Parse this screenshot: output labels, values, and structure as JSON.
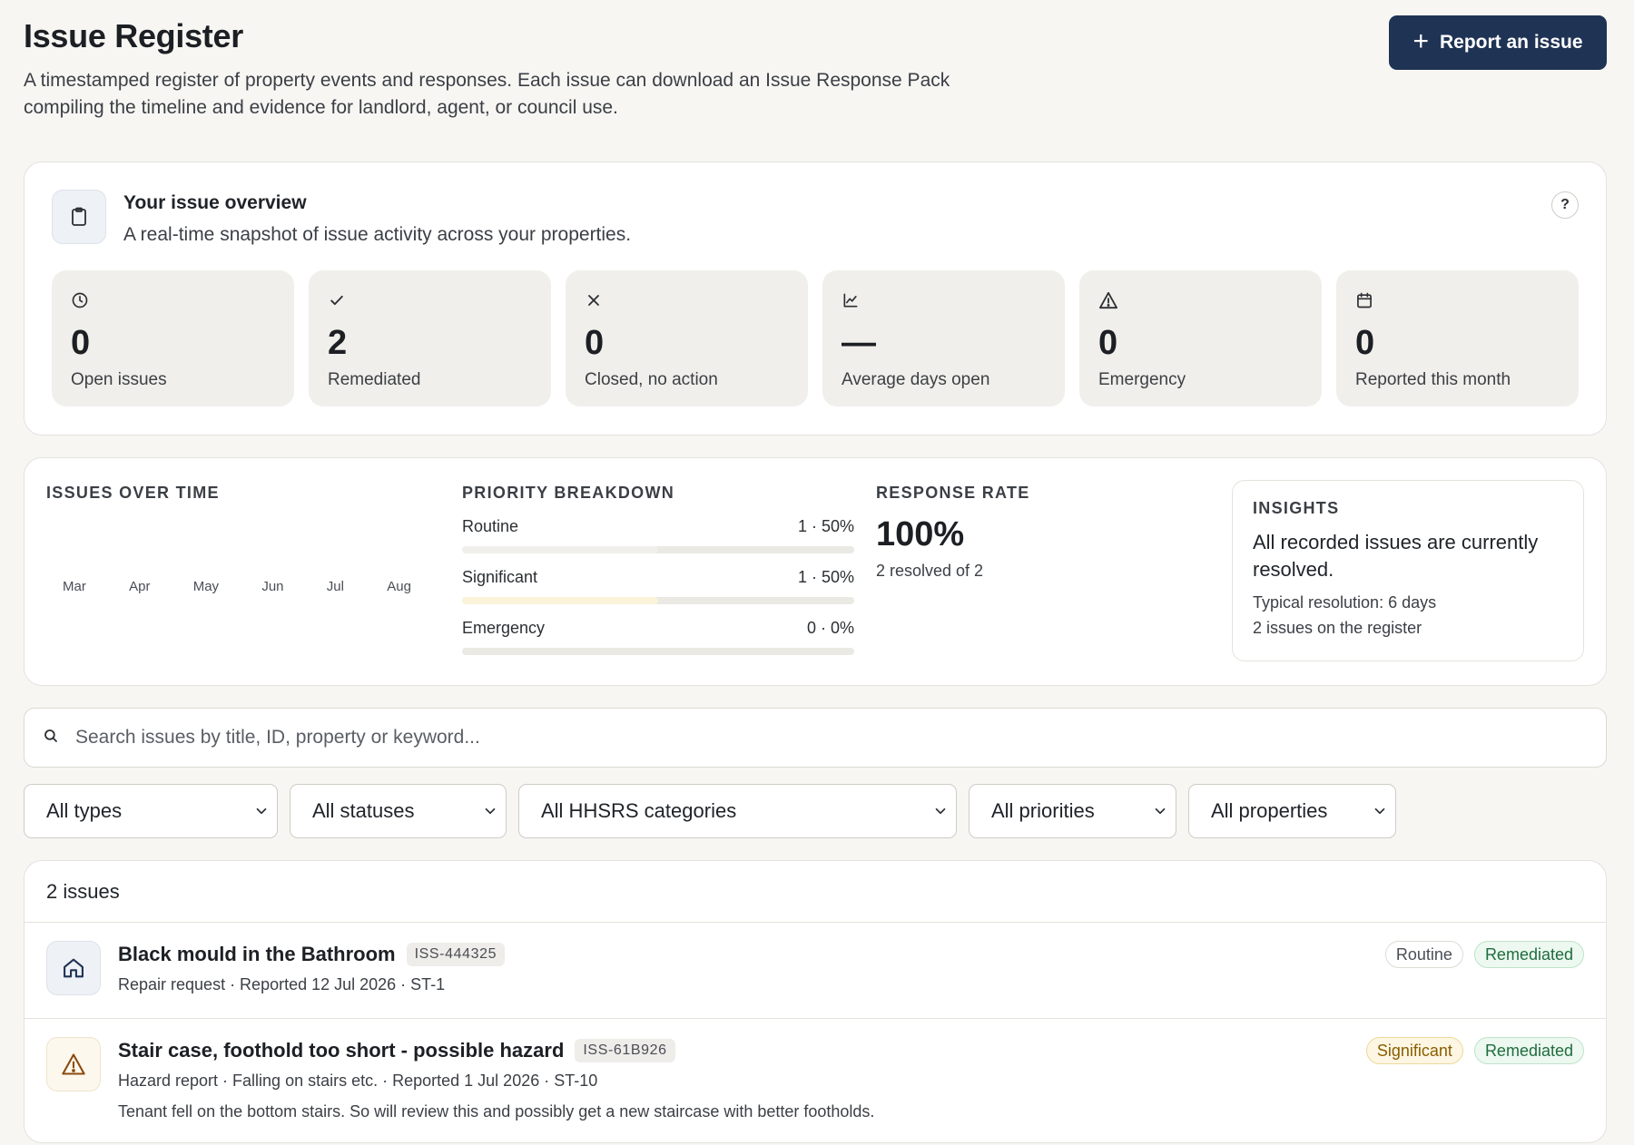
{
  "header": {
    "title": "Issue Register",
    "description": "A timestamped register of property events and responses. Each issue can download an Issue Response Pack compiling the timeline and evidence for landlord, agent, or council use.",
    "report_button": "Report an issue"
  },
  "overview": {
    "title": "Your issue overview",
    "subtitle": "A real-time snapshot of issue activity across your properties.",
    "help": "?",
    "stats": [
      {
        "icon": "clock-icon",
        "value": "0",
        "label": "Open issues"
      },
      {
        "icon": "check-icon",
        "value": "2",
        "label": "Remediated"
      },
      {
        "icon": "x-icon",
        "value": "0",
        "label": "Closed, no action"
      },
      {
        "icon": "line-chart-icon",
        "value": "—",
        "label": "Average days open"
      },
      {
        "icon": "warning-icon",
        "value": "0",
        "label": "Emergency"
      },
      {
        "icon": "calendar-icon",
        "value": "0",
        "label": "Reported this month"
      }
    ]
  },
  "analytics": {
    "issues_over_time": {
      "label": "ISSUES OVER TIME",
      "months": [
        "Mar",
        "Apr",
        "May",
        "Jun",
        "Jul",
        "Aug"
      ]
    },
    "priority_breakdown": {
      "label": "PRIORITY BREAKDOWN",
      "rows": [
        {
          "name": "Routine",
          "value": "1 · 50%",
          "fraction": 0.5,
          "color": "#f1efeb"
        },
        {
          "name": "Significant",
          "value": "1 · 50%",
          "fraction": 0.5,
          "color": "#fbf3da"
        },
        {
          "name": "Emergency",
          "value": "0 · 0%",
          "fraction": 0,
          "color": "#f3d9d9"
        }
      ]
    },
    "response_rate": {
      "label": "RESPONSE RATE",
      "value": "100%",
      "sub": "2 resolved of 2"
    },
    "insights": {
      "label": "INSIGHTS",
      "main": "All recorded issues are currently resolved.",
      "line1": "Typical resolution: 6 days",
      "line2": "2 issues on the register"
    }
  },
  "search": {
    "placeholder": "Search issues by title, ID, property or keyword..."
  },
  "filters": [
    {
      "label": "All types"
    },
    {
      "label": "All statuses"
    },
    {
      "label": "All HHSRS categories"
    },
    {
      "label": "All priorities"
    },
    {
      "label": "All properties"
    }
  ],
  "issues": {
    "count_label": "2 issues",
    "items": [
      {
        "icon": "home-icon",
        "title": "Black mould in the Bathroom",
        "id": "ISS-444325",
        "meta": "Repair request · Reported 12 Jul 2026 · ST-1",
        "note": "",
        "priority": "Routine",
        "status": "Remediated"
      },
      {
        "icon": "warning-icon",
        "title": "Stair case, foothold too short - possible hazard",
        "id": "ISS-61B926",
        "meta": "Hazard report · Falling on stairs etc. · Reported 1 Jul 2026 · ST-10",
        "note": "Tenant fell on the bottom stairs. So will review this and possibly get a new staircase with better footholds.",
        "priority": "Significant",
        "status": "Remediated"
      }
    ]
  }
}
